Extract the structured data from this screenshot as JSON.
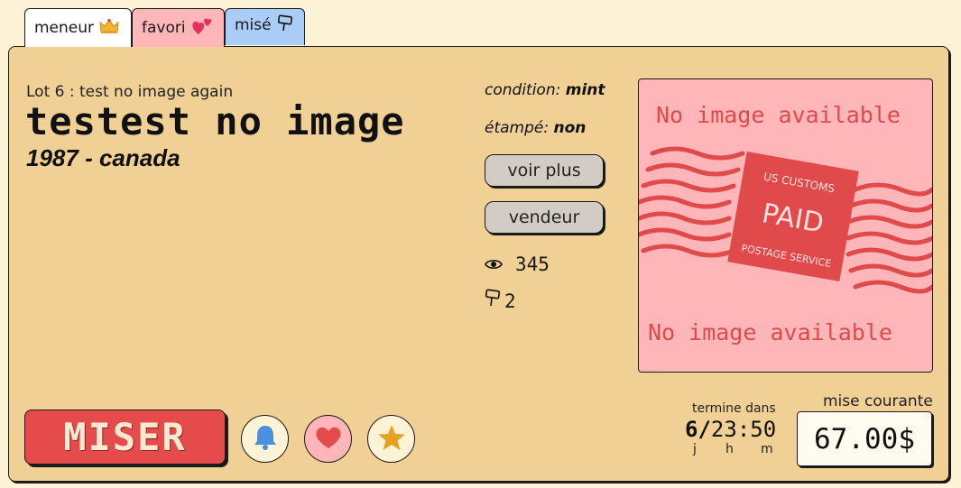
{
  "tabs": [
    {
      "label": "meneur",
      "icon": "crown-icon"
    },
    {
      "label": "favori",
      "icon": "hearts-icon"
    },
    {
      "label": "misé",
      "icon": "gavel-icon"
    }
  ],
  "lot": {
    "lot_line": "Lot 6 : test no image again",
    "title": "testest no image",
    "year_country": "1987 - canada",
    "condition_label": "condition:",
    "condition_value": "mint",
    "stamped_label": "étampé:",
    "stamped_value": "non",
    "views": "345",
    "bids": "2"
  },
  "buttons": {
    "voir_plus": "voir plus",
    "vendeur": "vendeur",
    "miser": "MISER"
  },
  "image_placeholder": {
    "top_text": "No image available",
    "bottom_text": "No image available",
    "stamp_line1": "US CUSTOMS",
    "stamp_main": "PAID",
    "stamp_line2": "POSTAGE SERVICE"
  },
  "timer": {
    "label": "termine dans",
    "days": "6",
    "hours": "23",
    "minutes": "50",
    "unit_days": "j",
    "unit_hours": "h",
    "unit_minutes": "m"
  },
  "current_bid": {
    "label": "mise courante",
    "value": "67.00$"
  },
  "colors": {
    "card_bg": "#f0d095",
    "miser_red": "#e54b4b",
    "placeholder_pink": "#ffb6b9",
    "mise_tab_blue": "#a9cdf7"
  }
}
